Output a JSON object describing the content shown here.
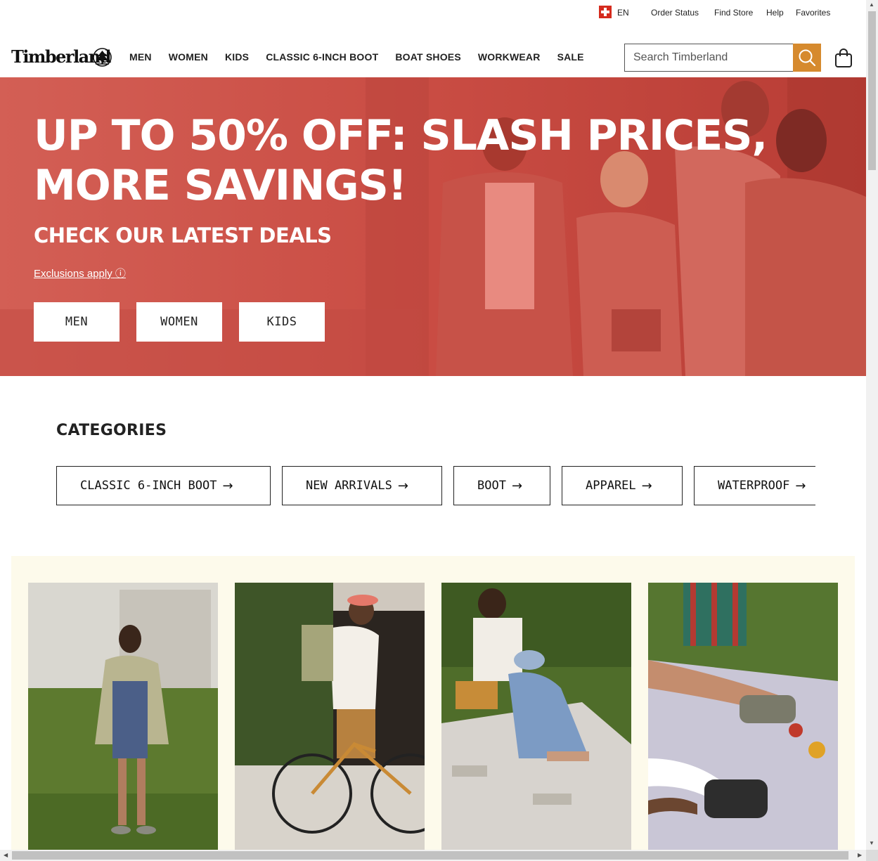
{
  "utility": {
    "language": "EN",
    "links": [
      "Order Status",
      "Find Store",
      "Help",
      "Favorites"
    ]
  },
  "header": {
    "logo": "Timberland",
    "nav": [
      "MEN",
      "WOMEN",
      "KIDS",
      "CLASSIC 6-INCH BOOT",
      "BOAT SHOES",
      "WORKWEAR",
      "SALE"
    ],
    "search_placeholder": "Search Timberland"
  },
  "hero": {
    "title_line1": "UP TO 50% OFF: SLASH PRICES,",
    "title_line2": "MORE SAVINGS!",
    "subtitle": "CHECK OUR LATEST DEALS",
    "exclusions": "Exclusions apply",
    "exclusions_icon": "ⓘ",
    "buttons": [
      "MEN",
      "WOMEN",
      "KIDS"
    ]
  },
  "categories": {
    "title": "CATEGORIES",
    "items": [
      "CLASSIC 6-INCH BOOT",
      "NEW ARRIVALS",
      "BOOT",
      "APPAREL",
      "WATERPROOF"
    ],
    "arrow": "→"
  },
  "colors": {
    "hero_red": "#d0554b",
    "search_orange": "#d68a2e",
    "promo_bg": "#fdfaeb"
  }
}
